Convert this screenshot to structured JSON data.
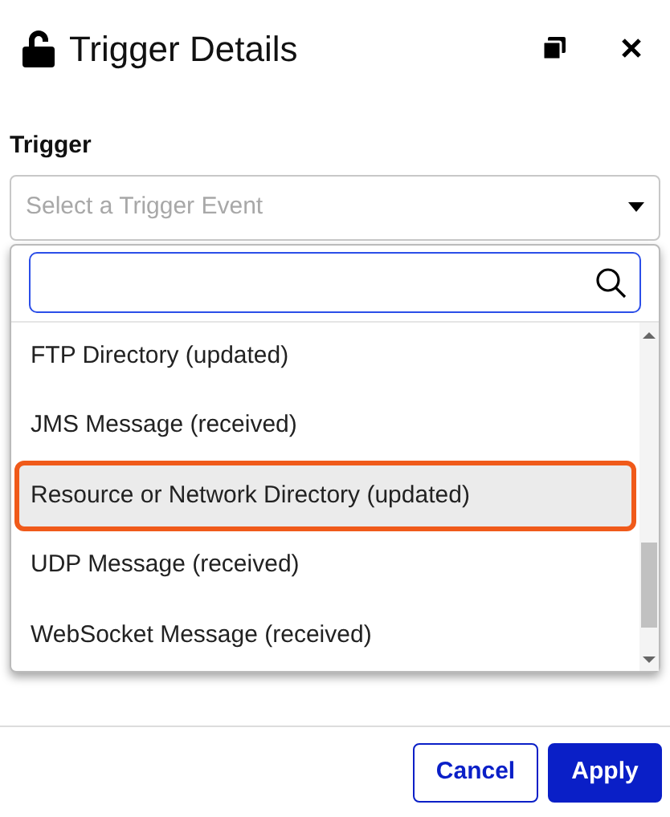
{
  "dialog": {
    "title": "Trigger Details"
  },
  "trigger": {
    "label": "Trigger",
    "placeholder": "Select a Trigger Event",
    "expanded": true
  },
  "dropdown": {
    "options": [
      {
        "label": "FTP Directory (updated)",
        "selected": false
      },
      {
        "label": "JMS Message (received)",
        "selected": false
      },
      {
        "label": "Resource or Network Directory (updated)",
        "selected": true
      },
      {
        "label": "UDP Message (received)",
        "selected": false
      },
      {
        "label": "WebSocket Message (received)",
        "selected": false
      }
    ]
  },
  "buttons": [
    {
      "label": "Cancel",
      "kind": "secondary"
    },
    {
      "label": "Apply",
      "kind": "primary"
    }
  ]
}
